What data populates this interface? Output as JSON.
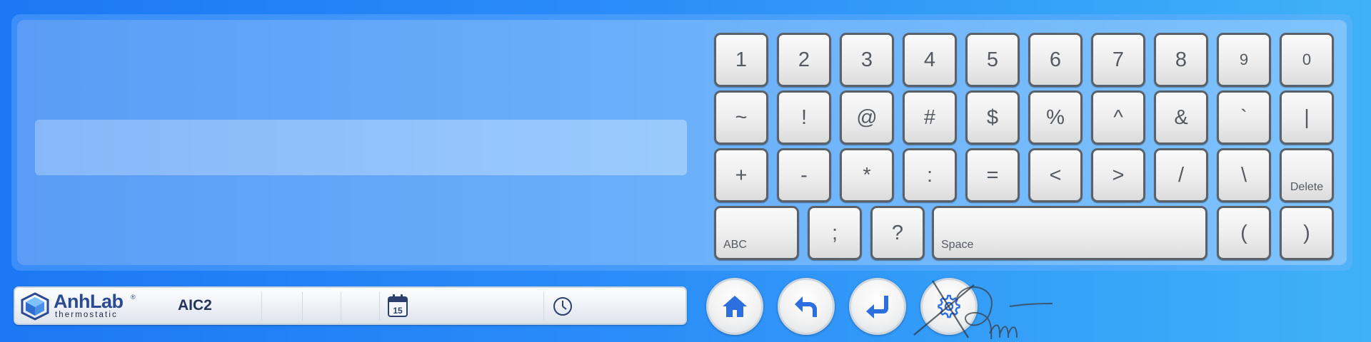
{
  "input": {
    "value": "",
    "placeholder": ""
  },
  "keyboard": {
    "rows": [
      [
        "1",
        "2",
        "3",
        "4",
        "5",
        "6",
        "7",
        "8",
        "9",
        "0"
      ],
      [
        "~",
        "!",
        "@",
        "#",
        "$",
        "%",
        "^",
        "&",
        "`",
        "|"
      ],
      [
        "+",
        "-",
        "*",
        ":",
        "=",
        "<",
        ">",
        "/",
        "\\",
        "Delete"
      ],
      [
        "ABC",
        ";",
        "?",
        "Space",
        "(",
        ")"
      ]
    ]
  },
  "status_bar": {
    "logo_name": "AnhLab",
    "logo_reg": "®",
    "logo_sub": "thermostatic",
    "title": "AIC2",
    "calendar_day": "15",
    "date": "",
    "time": ""
  },
  "nav": {
    "buttons": [
      "home",
      "back",
      "enter",
      "settings"
    ]
  },
  "colors": {
    "background_start": "#1c78f4",
    "background_end": "#3fb1f8",
    "key_border": "#5b6168",
    "brand": "#2b4a91",
    "nav_icon": "#2e6fe0"
  },
  "icons": [
    "calendar-icon",
    "clock-icon",
    "home-icon",
    "back-arrow-icon",
    "enter-icon",
    "gear-icon"
  ]
}
